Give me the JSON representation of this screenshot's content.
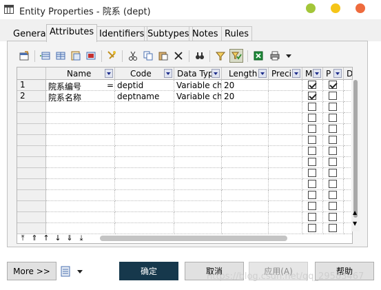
{
  "window": {
    "title": "Entity Properties - 院系 (dept)",
    "dots": [
      "#a3c639",
      "#f5c518",
      "#ee6b3d"
    ]
  },
  "tabs": [
    {
      "label": "General",
      "active": false
    },
    {
      "label": "Attributes",
      "active": true
    },
    {
      "label": "Identifiers",
      "active": false
    },
    {
      "label": "Subtypes",
      "active": false
    },
    {
      "label": "Notes",
      "active": false
    },
    {
      "label": "Rules",
      "active": false
    }
  ],
  "toolbar": {
    "icons": [
      "properties-icon",
      "insert-row-icon",
      "add-row-icon",
      "add-attributes-icon",
      "reuse-attributes-icon",
      "find-icon",
      "cut-icon",
      "copy-icon",
      "paste-icon",
      "delete-icon",
      "find-in-list-icon",
      "filter-icon",
      "filter-active-icon",
      "export-excel-icon",
      "print-icon",
      "dropdown-icon"
    ]
  },
  "grid": {
    "columns": [
      "Name",
      "Code",
      "Data Typ",
      "Length",
      "Preci",
      "M",
      "P",
      "D"
    ],
    "rows": [
      {
        "num": "1",
        "name": "院系编号",
        "marker": "=",
        "code": "deptid",
        "data_type": "Variable char",
        "length": "20",
        "precision": "",
        "mandatory": true,
        "primary": true
      },
      {
        "num": "2",
        "name": "院系名称",
        "marker": "",
        "code": "deptname",
        "data_type": "Variable char",
        "length": "20",
        "precision": "",
        "mandatory": true,
        "primary": false
      }
    ],
    "empty_row_count": 12
  },
  "nav_buttons": [
    "⤒",
    "⇑",
    "↑",
    "↓",
    "⇓",
    "⤓"
  ],
  "buttons": {
    "more": "More >>",
    "ok": "确定",
    "cancel": "取消",
    "apply": "应用(A)",
    "help": "帮助"
  },
  "watermark": "https://blog.csdn.net/qq_29583467"
}
